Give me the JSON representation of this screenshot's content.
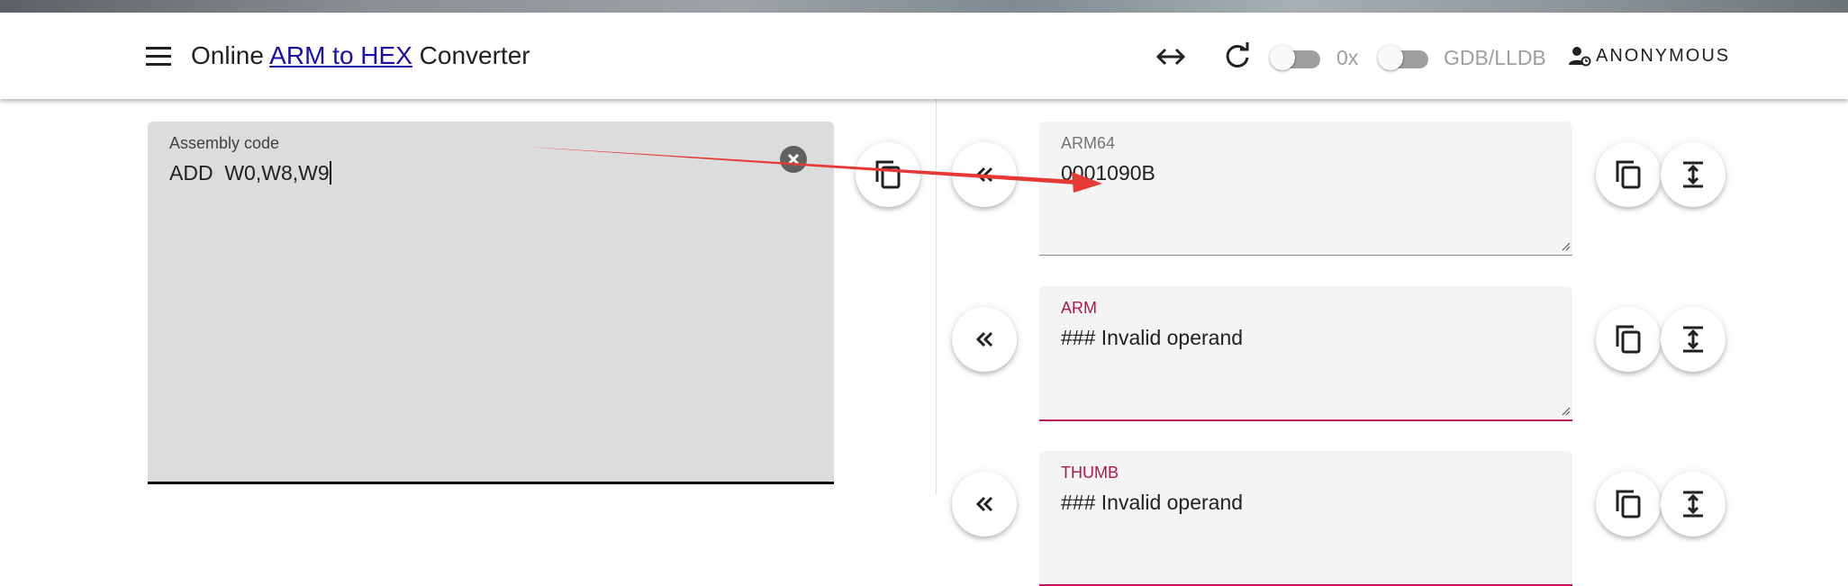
{
  "header": {
    "title_prefix": "Online ",
    "title_link": "ARM to HEX",
    "title_suffix": " Converter",
    "toggle_0x_label": "0x",
    "toggle_gdb_label": "GDB/LLDB",
    "user_label": "ANONYMOUS"
  },
  "assembly": {
    "label": "Assembly code",
    "value": "ADD  W0,W8,W9"
  },
  "outputs": [
    {
      "label": "ARM64",
      "value": "0001090B",
      "status": "ok"
    },
    {
      "label": "ARM",
      "value": "### Invalid operand",
      "status": "error"
    },
    {
      "label": "THUMB",
      "value": "### Invalid operand",
      "status": "error"
    }
  ],
  "icons": {
    "menu": "menu-icon",
    "swap": "swap-horiz-icon",
    "refresh": "refresh-icon",
    "user": "user-icon",
    "clear": "clear-icon",
    "copy": "copy-icon",
    "convert_back": "double-chevron-left-icon",
    "expand": "expand-vertical-icon"
  },
  "colors": {
    "link": "#1a0dab",
    "error": "#b0174a",
    "annotation_arrow": "#e53935",
    "assembly_bg": "#dcdcdc",
    "output_bg": "#f4f4f4"
  }
}
